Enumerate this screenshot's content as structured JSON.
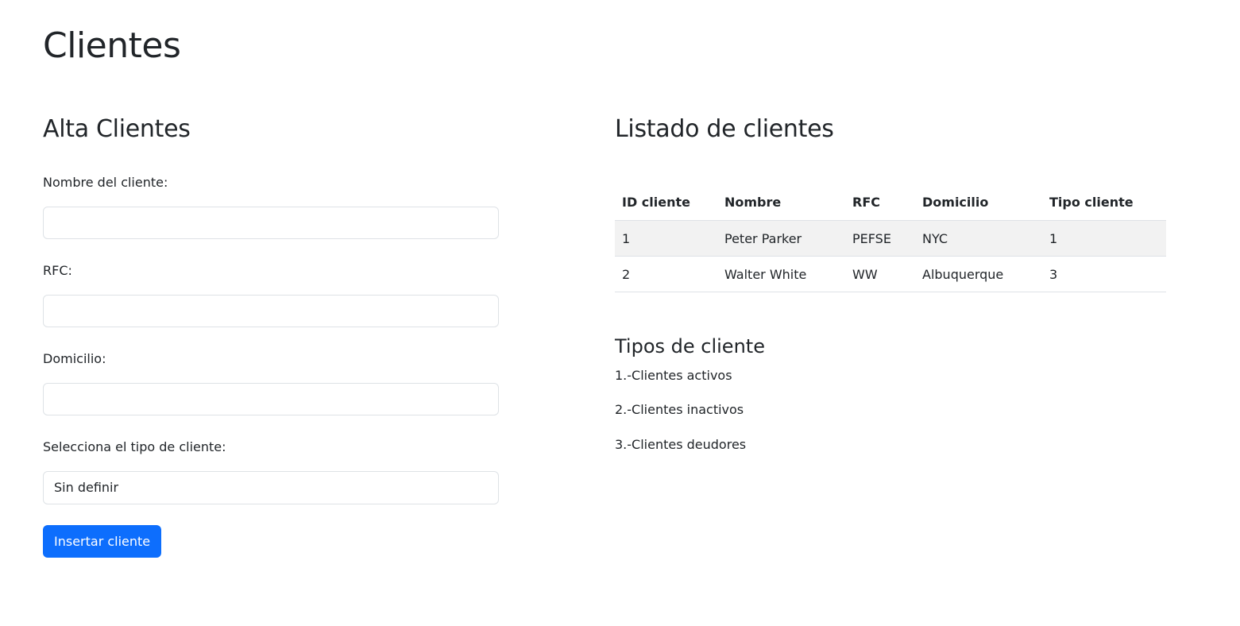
{
  "page": {
    "title": "Clientes"
  },
  "form": {
    "title": "Alta Clientes",
    "name_label": "Nombre del cliente:",
    "name_value": "",
    "rfc_label": "RFC:",
    "rfc_value": "",
    "address_label": "Domicilio:",
    "address_value": "",
    "type_label": "Selecciona el tipo de cliente:",
    "type_selected": "Sin definir",
    "submit_label": "Insertar cliente"
  },
  "listing": {
    "title": "Listado de clientes",
    "columns": [
      "ID cliente",
      "Nombre",
      "RFC",
      "Domicilio",
      "Tipo cliente"
    ],
    "rows": [
      [
        "1",
        "Peter Parker",
        "PEFSE",
        "NYC",
        "1"
      ],
      [
        "2",
        "Walter White",
        "WW",
        "Albuquerque",
        "3"
      ]
    ]
  },
  "types": {
    "title": "Tipos de cliente",
    "items": [
      "1.-Clientes activos",
      "2.-Clientes inactivos",
      "3.-Clientes deudores"
    ]
  },
  "colors": {
    "primary": "#0d6efd",
    "text": "#212529",
    "border": "#dee2e6",
    "stripe": "#f2f2f2"
  }
}
